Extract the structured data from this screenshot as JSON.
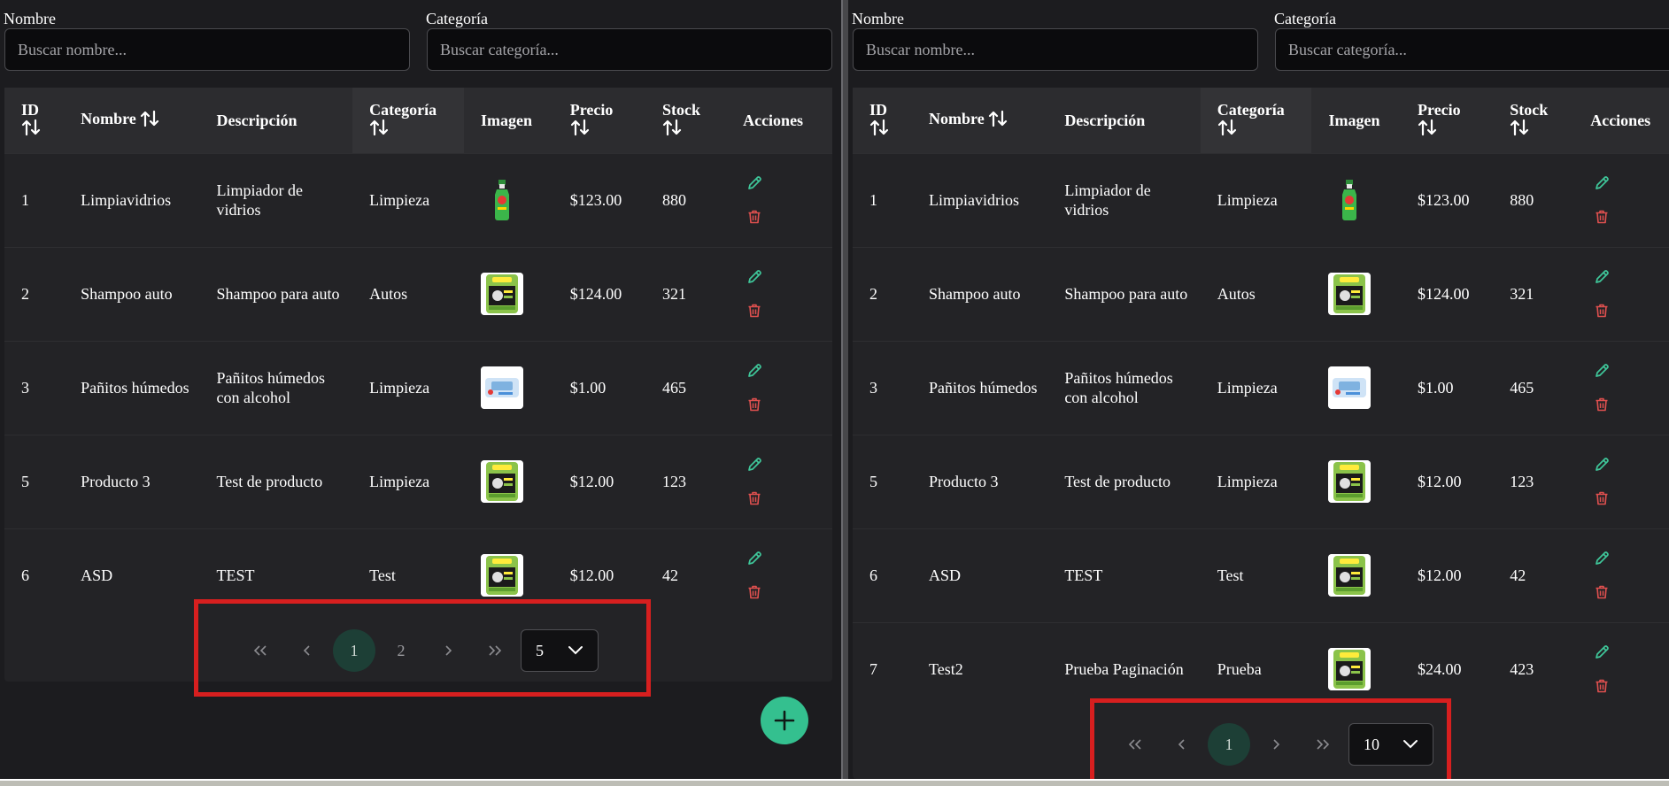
{
  "filters": {
    "name_label": "Nombre",
    "name_placeholder": "Buscar nombre...",
    "category_label": "Categoría",
    "category_placeholder": "Buscar categoría..."
  },
  "table": {
    "headers": {
      "id": "ID",
      "name": "Nombre",
      "description": "Descripción",
      "category": "Categoría",
      "image": "Imagen",
      "price": "Precio",
      "stock": "Stock",
      "actions": "Acciones"
    },
    "rows": [
      {
        "id": "1",
        "name": "Limpiavidrios",
        "description": "Limpiador de vidrios",
        "category": "Limpieza",
        "image": "spray-bottle",
        "price": "$123.00",
        "stock": "880"
      },
      {
        "id": "2",
        "name": "Shampoo auto",
        "description": "Shampoo para auto",
        "category": "Autos",
        "image": "shampoo-box",
        "price": "$124.00",
        "stock": "321"
      },
      {
        "id": "3",
        "name": "Pañitos húmedos",
        "description": "Pañitos húmedos con alcohol",
        "category": "Limpieza",
        "image": "wipes-pack",
        "price": "$1.00",
        "stock": "465"
      },
      {
        "id": "5",
        "name": "Producto 3",
        "description": "Test de producto",
        "category": "Limpieza",
        "image": "shampoo-box",
        "price": "$12.00",
        "stock": "123"
      },
      {
        "id": "6",
        "name": "ASD",
        "description": "TEST",
        "category": "Test",
        "image": "shampoo-box",
        "price": "$12.00",
        "stock": "42"
      },
      {
        "id": "7",
        "name": "Test2",
        "description": "Prueba Paginación",
        "category": "Prueba",
        "image": "shampoo-box",
        "price": "$24.00",
        "stock": "423"
      }
    ]
  },
  "left_panel": {
    "visible_rows": 5,
    "pages": [
      "1",
      "2"
    ],
    "active_page": "1",
    "rows_per_page": "5"
  },
  "right_panel": {
    "visible_rows": 6,
    "pages": [
      "1"
    ],
    "active_page": "1",
    "rows_per_page": "10"
  },
  "icons": {
    "first": "double-chevron-left-icon",
    "prev": "chevron-left-icon",
    "next": "chevron-right-icon",
    "last": "double-chevron-right-icon",
    "dropdown": "chevron-down-icon",
    "edit": "pencil-icon",
    "delete": "trash-icon",
    "add": "plus-icon",
    "sort": "sort-arrows-icon"
  },
  "colors": {
    "background": "#1c1c1f",
    "edit": "#3fc79a",
    "delete": "#e0504f",
    "fab": "#34c08f",
    "active_page": "#1d3f36",
    "highlight": "#d71f1f"
  }
}
